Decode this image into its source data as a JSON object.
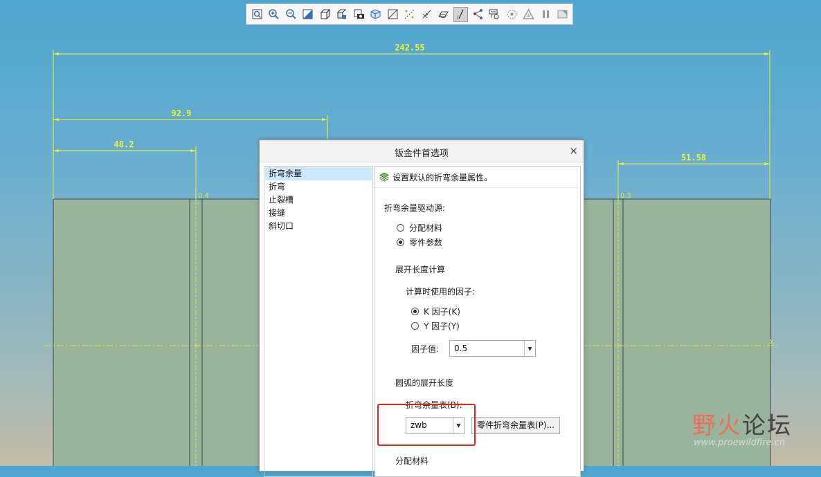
{
  "toolbar": {
    "buttons": [
      {
        "icon": "zoom-fit-icon"
      },
      {
        "icon": "zoom-in-icon"
      },
      {
        "icon": "zoom-out-icon"
      },
      {
        "icon": "shading-icon"
      },
      {
        "icon": "view-orientation-icon"
      },
      {
        "icon": "saved-views-icon"
      },
      {
        "icon": "camera-icon"
      },
      {
        "icon": "display-style-icon"
      },
      {
        "icon": "datum-plane-icon"
      },
      {
        "icon": "datum-axis-icon"
      },
      {
        "icon": "datum-point-icon"
      },
      {
        "icon": "csys-icon",
        "active": true
      },
      {
        "icon": "network-icon"
      },
      {
        "icon": "annotation-icon"
      },
      {
        "icon": "spin-center-icon"
      },
      {
        "icon": "warning-triangle-icon"
      },
      {
        "icon": "pause-icon"
      },
      {
        "icon": "refit-icon"
      }
    ]
  },
  "drawing": {
    "dimensions": {
      "overall": "242.55",
      "mid": "92.9",
      "left": "48.2",
      "right": "51.58"
    },
    "bend_labels": [
      "0.4",
      "0.3"
    ],
    "axis_label": "X",
    "colors": {
      "dim": "#f2f22a",
      "part_fill": "#98b49c",
      "part_edge": "#3e4a44",
      "centerline": "#e6e23a"
    }
  },
  "dialog": {
    "title": "钣金件首选项",
    "close_label": "×",
    "nav": [
      "折弯余量",
      "折弯",
      "止裂槽",
      "接缝",
      "斜切口"
    ],
    "selected_nav_index": 0,
    "header": "设置默认的折弯余量属性。",
    "driver_source_label": "折弯余量驱动源:",
    "driver_options": [
      "分配材料",
      "零件参数"
    ],
    "driver_selected": 1,
    "dev_length_label": "展开长度计算",
    "factor_used_label": "计算时使用的因子:",
    "factor_options": [
      "K 因子(K)",
      "Y 因子(Y)"
    ],
    "factor_selected": 0,
    "factor_value_label": "因子值:",
    "factor_value": "0.5",
    "arc_dev_label": "圆弧的展开长度",
    "bend_table_label": "折弯余量表(B):",
    "bend_table_value": "zwb",
    "part_table_button": "零件折弯余量表(P)...",
    "assign_material_label": "分配材料"
  },
  "watermark": {
    "text_a": "野火",
    "text_b": "论坛",
    "url": "www.proewildfire.cn"
  }
}
